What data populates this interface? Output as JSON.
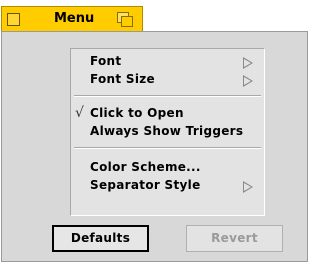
{
  "tab": {
    "title": "Menu",
    "left_icon": "window-close-box-icon",
    "right_icon": "window-zoom-box-icon"
  },
  "menu_items": [
    {
      "label": "Font",
      "checked": false,
      "submenu": true
    },
    {
      "label": "Font Size",
      "checked": false,
      "submenu": true
    },
    {
      "label": "Click to Open",
      "checked": true,
      "submenu": false
    },
    {
      "label": "Always Show Triggers",
      "checked": false,
      "submenu": false
    },
    {
      "label": "Color Scheme...",
      "checked": false,
      "submenu": false
    },
    {
      "label": "Separator Style",
      "checked": false,
      "submenu": true
    }
  ],
  "check_glyph": "√",
  "buttons": {
    "defaults": "Defaults",
    "revert": "Revert"
  },
  "colors": {
    "tab": "#ffcc00",
    "window": "#d8d8d8",
    "panel": "#e3e3e3",
    "disabled_text": "#9a9a9a"
  }
}
